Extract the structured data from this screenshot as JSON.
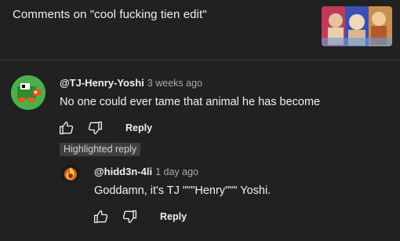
{
  "header": {
    "title": "Comments on \"cool fucking tien edit\""
  },
  "comments": [
    {
      "author": "@TJ-Henry-Yoshi",
      "time": "3 weeks ago",
      "text": "No one could ever tame that animal he has become",
      "reply_label": "Reply"
    }
  ],
  "highlight": {
    "label": "Highlighted reply"
  },
  "replies": [
    {
      "author": "@hidd3n-4li",
      "time": "1 day ago",
      "text": "Goddamn, it's TJ \"\"\"Henry\"\"\" Yoshi.",
      "reply_label": "Reply"
    }
  ],
  "colors": {
    "background": "#212121",
    "text": "#f1f1f1",
    "secondary": "#aaaaaa",
    "badge": "#3f3f3f"
  }
}
